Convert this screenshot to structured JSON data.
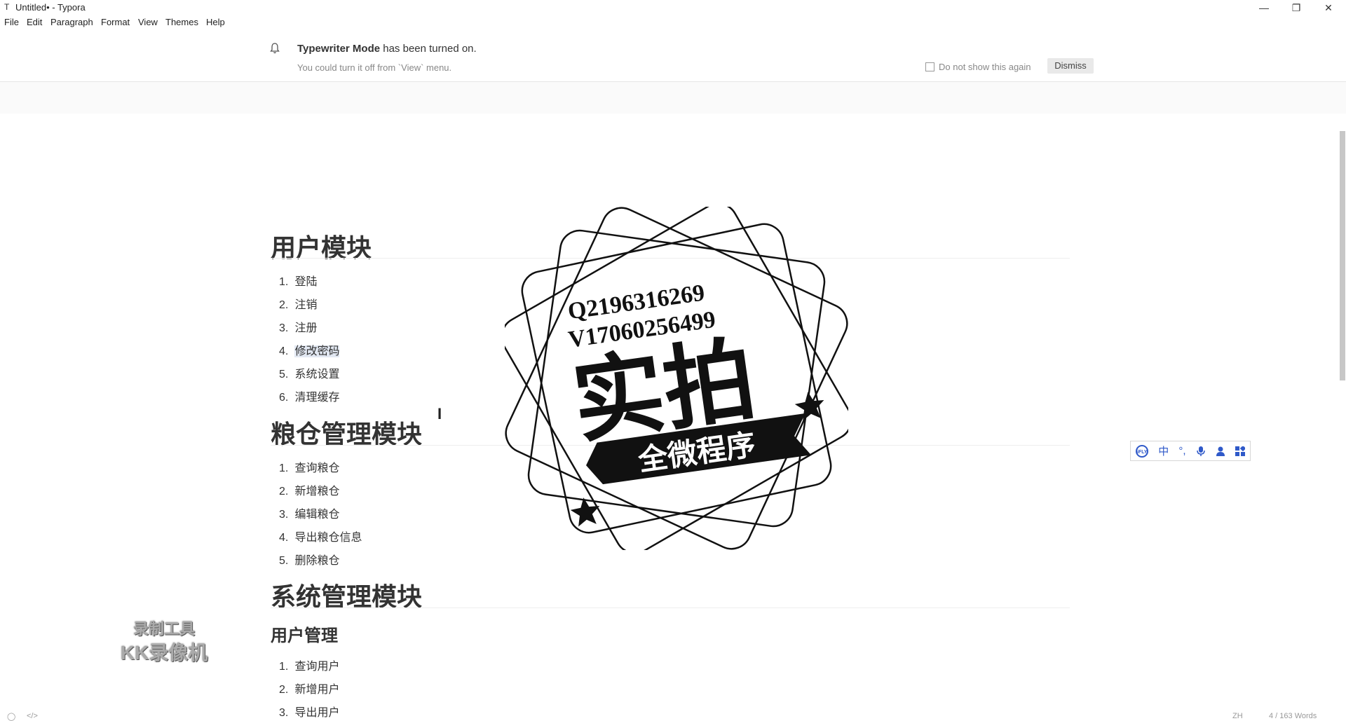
{
  "window": {
    "app_icon": "T",
    "title": "Untitled• - Typora",
    "minimize": "—",
    "restore": "❐",
    "close": "✕"
  },
  "menu": [
    "File",
    "Edit",
    "Paragraph",
    "Format",
    "View",
    "Themes",
    "Help"
  ],
  "notice": {
    "title_bold": "Typewriter Mode",
    "title_rest": " has been turned on.",
    "subtitle": "You could turn it off from `View` menu.",
    "dont_show_label": "Do not show this again",
    "dismiss_label": "Dismiss"
  },
  "document": {
    "sections": [
      {
        "heading": "用户模块",
        "items": [
          "登陆",
          "注销",
          "注册",
          "修改密码",
          "系统设置",
          "清理缓存"
        ]
      },
      {
        "heading": "粮仓管理模块",
        "items": [
          "查询粮仓",
          "新增粮仓",
          "编辑粮仓",
          "导出粮仓信息",
          "删除粮仓"
        ]
      },
      {
        "heading": "系统管理模块",
        "subheading": "用户管理",
        "items": [
          "查询用户",
          "新增用户",
          "导出用户"
        ]
      }
    ]
  },
  "ime": {
    "iflytek": "iFLY",
    "mode": "中",
    "punct": "°,",
    "icons": [
      "iflytek-icon",
      "microphone-icon",
      "user-icon",
      "grid-icon"
    ]
  },
  "stamp": {
    "line1": "Q2196316269",
    "line2": "V17060256499",
    "big": "实拍",
    "ribbon": "全微程序"
  },
  "recorder": {
    "line1": "录制工具",
    "line2": "KK录像机"
  },
  "status": {
    "lang": "ZH",
    "words": "4 / 163 Words"
  }
}
